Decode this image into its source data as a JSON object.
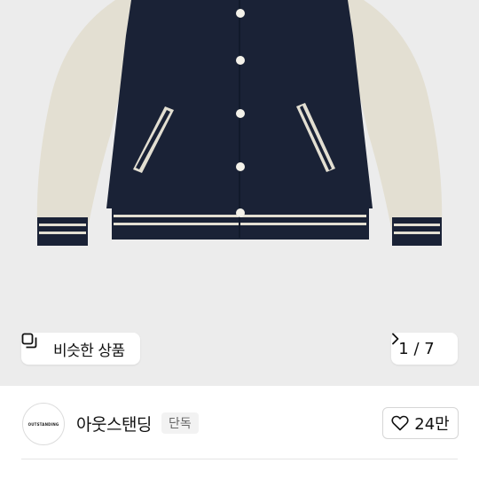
{
  "product": {
    "image_alt_icon": "jacket-photo",
    "similar_button": {
      "label": "비슷한 상품",
      "icon": "similar-products-icon"
    },
    "image_counter": {
      "text": "1 / 7",
      "icon": "chevron-right-icon"
    }
  },
  "brand": {
    "logo_text": "OUTSTANDING",
    "name": "아웃스탠딩",
    "badge": "단독"
  },
  "like": {
    "icon": "heart-icon",
    "count": "24만"
  },
  "colors": {
    "navy": "#1a2236",
    "cream": "#e3dfd2",
    "background": "#ececec"
  }
}
